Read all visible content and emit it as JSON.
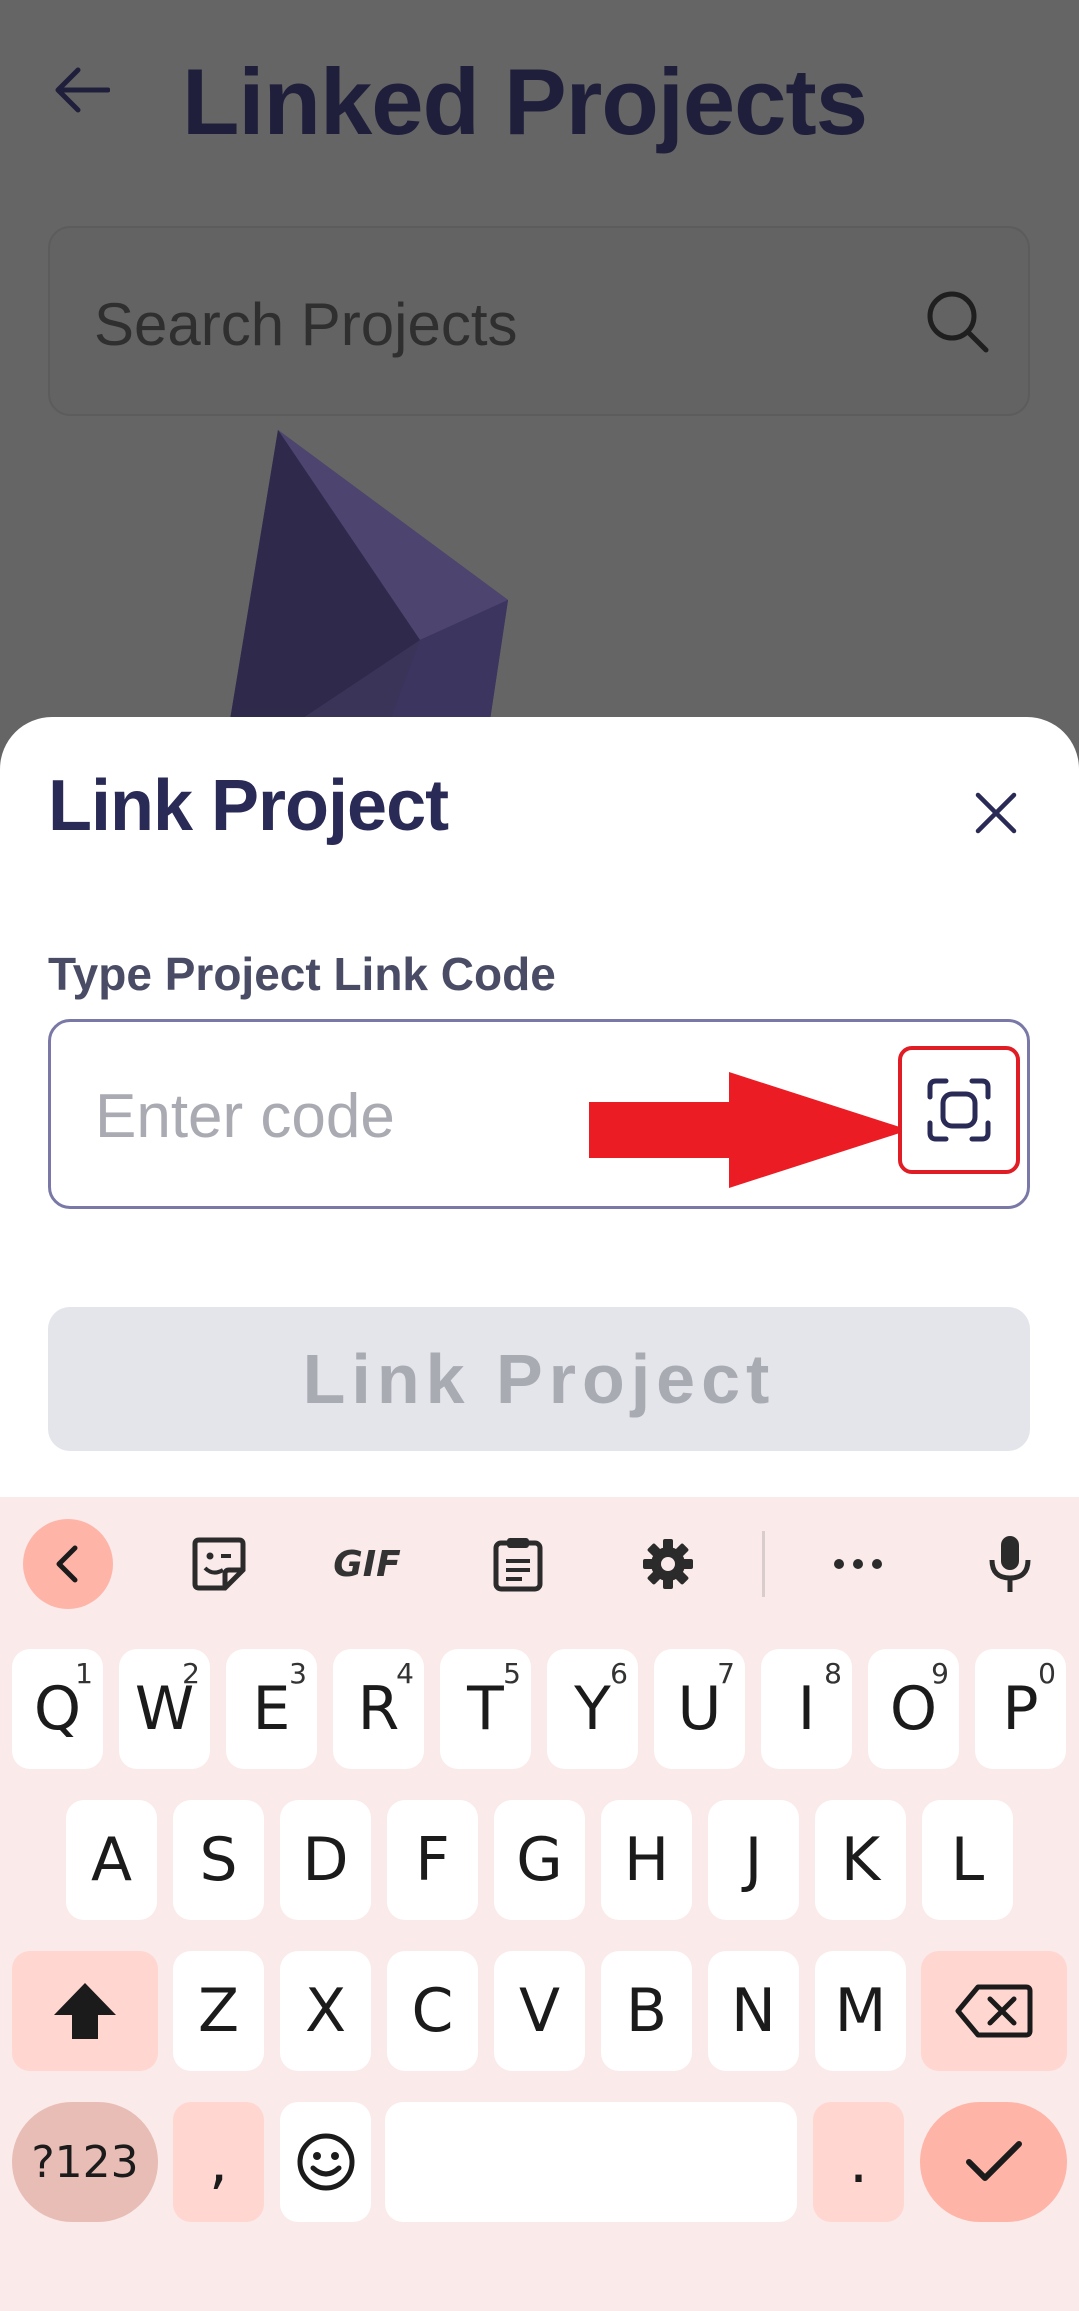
{
  "header": {
    "title": "Linked Projects",
    "back_icon": "arrow-left-icon"
  },
  "search": {
    "placeholder": "Search Projects",
    "icon": "search-icon"
  },
  "sheet": {
    "title": "Link Project",
    "field_label": "Type Project Link Code",
    "code_placeholder": "Enter code",
    "code_value": "",
    "scan_icon": "qr-scan-icon",
    "submit_label": "Link Project",
    "close_icon": "close-icon",
    "annotation_color": "#e01c24"
  },
  "keyboard": {
    "toolbar": [
      "collapse-icon",
      "sticker-icon",
      "GIF",
      "clipboard-icon",
      "gear-icon",
      "more-icon",
      "mic-icon"
    ],
    "row1": [
      {
        "k": "Q",
        "h": "1"
      },
      {
        "k": "W",
        "h": "2"
      },
      {
        "k": "E",
        "h": "3"
      },
      {
        "k": "R",
        "h": "4"
      },
      {
        "k": "T",
        "h": "5"
      },
      {
        "k": "Y",
        "h": "6"
      },
      {
        "k": "U",
        "h": "7"
      },
      {
        "k": "I",
        "h": "8"
      },
      {
        "k": "O",
        "h": "9"
      },
      {
        "k": "P",
        "h": "0"
      }
    ],
    "row2": [
      "A",
      "S",
      "D",
      "F",
      "G",
      "H",
      "J",
      "K",
      "L"
    ],
    "row3": [
      "Z",
      "X",
      "C",
      "V",
      "B",
      "N",
      "M"
    ],
    "symbols_label": "?123",
    "comma": ",",
    "period": "."
  },
  "colors": {
    "accent": "#2a2a56",
    "keyboard_bg": "#faeaea",
    "key_special": "#ffd6d0",
    "enter": "#ffb4a8"
  }
}
